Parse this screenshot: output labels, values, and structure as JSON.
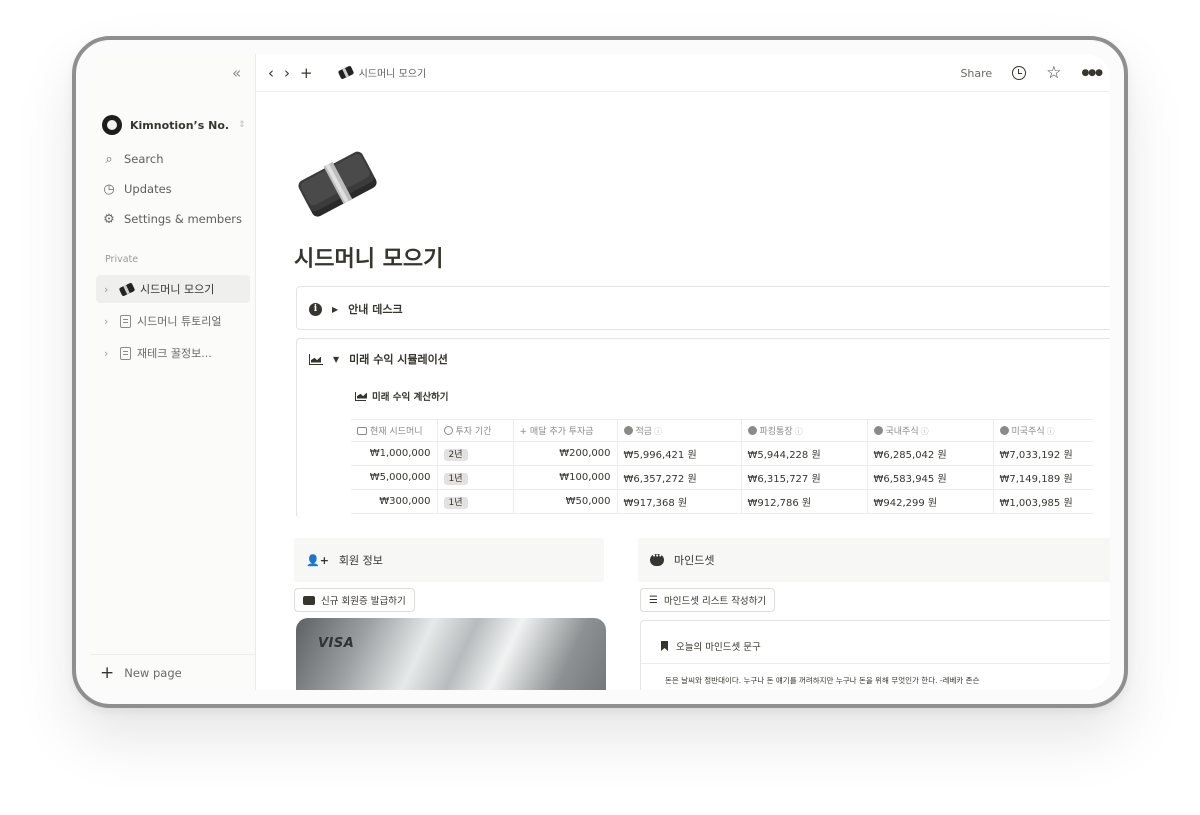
{
  "sidebar": {
    "workspace_name": "Kimnotion’s No...",
    "nav": [
      {
        "label": "Search",
        "icon": "search-icon"
      },
      {
        "label": "Updates",
        "icon": "clock-icon"
      },
      {
        "label": "Settings & members",
        "icon": "gear-icon"
      }
    ],
    "section_label": "Private",
    "pages": [
      {
        "label": "시드머니 모으기",
        "icon": "money-stack-icon",
        "active": true
      },
      {
        "label": "시드머니 튜토리얼",
        "icon": "document-icon",
        "active": false
      },
      {
        "label": "재테크 꿀정보...",
        "icon": "document-icon",
        "active": false
      }
    ],
    "new_page_label": "New page"
  },
  "topbar": {
    "breadcrumb": "시드머니 모으기",
    "share_label": "Share"
  },
  "page": {
    "title": "시드머니 모으기",
    "toggle1": "안내 데스크",
    "toggle2": "미래 수익 시뮬레이션",
    "calc_title": "미래 수익 계산하기",
    "table": {
      "headers": [
        "현재 시드머니",
        "투자 기간",
        "매달 추가 투자금",
        "적금",
        "파킹통장",
        "국내주식",
        "미국주식"
      ],
      "rows": [
        [
          "₩1,000,000",
          "2년",
          "₩200,000",
          "₩5,996,421 원",
          "₩5,944,228 원",
          "₩6,285,042 원",
          "₩7,033,192 원"
        ],
        [
          "₩5,000,000",
          "1년",
          "₩100,000",
          "₩6,357,272 원",
          "₩6,315,727 원",
          "₩6,583,945 원",
          "₩7,149,189 원"
        ],
        [
          "₩300,000",
          "1년",
          "₩50,000",
          "₩917,368 원",
          "₩912,786 원",
          "₩942,299 원",
          "₩1,003,985 원"
        ]
      ]
    },
    "member": {
      "heading": "회원 정보",
      "button": "신규 회원증 발급하기",
      "card_brand": "VISA"
    },
    "mindset": {
      "heading": "마인드셋",
      "button": "마인드셋 리스트 작성하기",
      "quote_title": "오늘의 마인드셋 문구",
      "quote_text": "돈은 날씨와 정반대이다. 누구나 돈 얘기를 꺼려하지만 누구나 돈을 위해 무엇인가 한다. -레베카 존슨"
    }
  }
}
